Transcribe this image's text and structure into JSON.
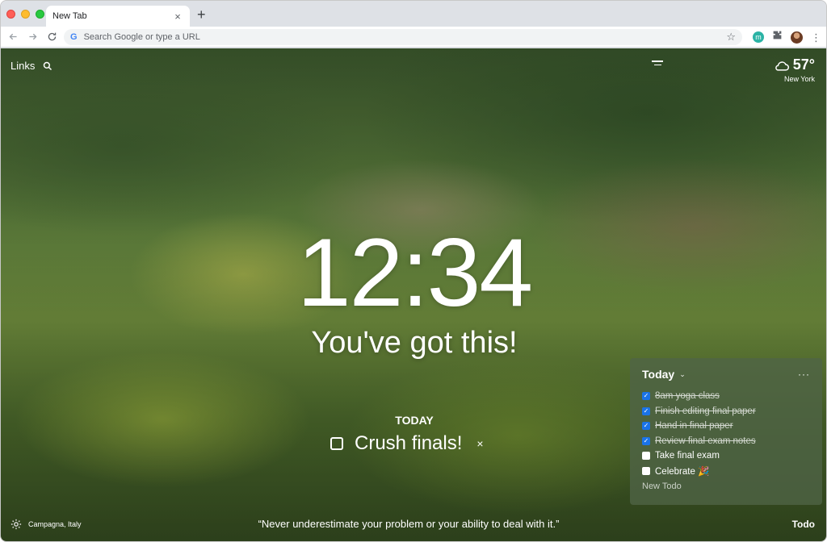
{
  "browser": {
    "tab_title": "New Tab",
    "tab_close": "×",
    "new_tab": "+",
    "omnibox_placeholder": "Search Google or type a URL",
    "omnibox_g": "G",
    "extension_letter": "m"
  },
  "header": {
    "links_label": "Links"
  },
  "weather": {
    "temperature": "57°",
    "city": "New York"
  },
  "main": {
    "clock": "12:34",
    "greeting": "You've got this!",
    "focus_label": "TODAY",
    "focus_text": "Crush finals!",
    "focus_close": "×"
  },
  "todo": {
    "title": "Today",
    "more": "···",
    "items": [
      {
        "label": "8am yoga class",
        "done": true
      },
      {
        "label": "Finish editing final paper",
        "done": true
      },
      {
        "label": "Hand in final paper",
        "done": true
      },
      {
        "label": "Review final exam notes",
        "done": true
      },
      {
        "label": "Take final exam",
        "done": false
      },
      {
        "label": "Celebrate 🎉",
        "done": false
      }
    ],
    "new_placeholder": "New Todo"
  },
  "footer": {
    "location": "Campagna, Italy",
    "quote": "“Never underestimate your problem or your ability to deal with it.”",
    "todo_link": "Todo"
  },
  "colors": {
    "accent": "#1a73e8",
    "tabstrip": "#dee1e6"
  }
}
